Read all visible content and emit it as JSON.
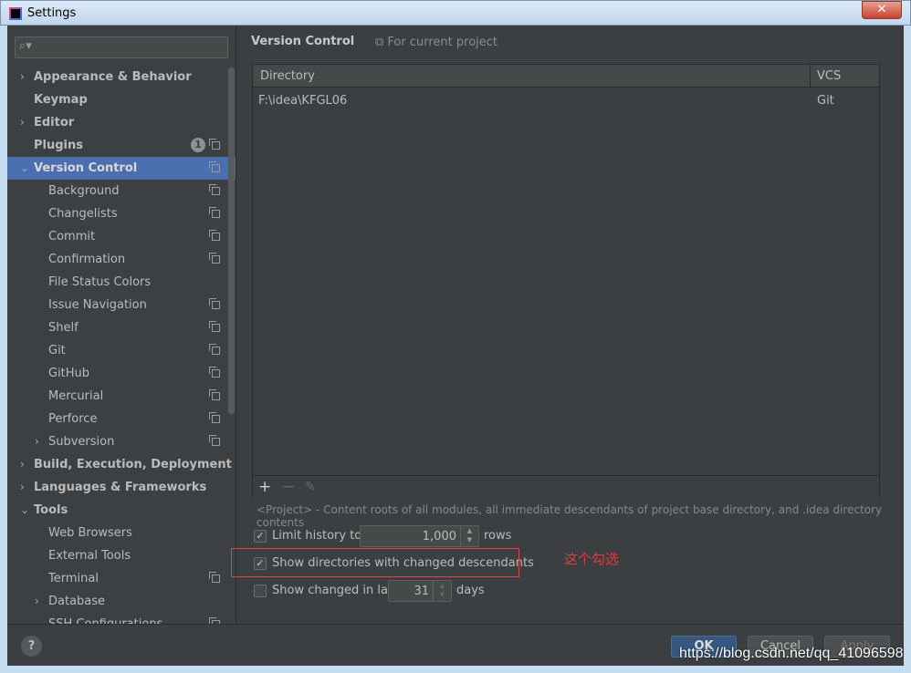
{
  "window": {
    "title": "Settings",
    "close": "✕"
  },
  "sidebar": {
    "search_placeholder": "",
    "items": [
      {
        "label": "Appearance & Behavior",
        "level": 1,
        "arrow": "›",
        "bold": true
      },
      {
        "label": "Keymap",
        "level": 1,
        "bold": true
      },
      {
        "label": "Editor",
        "level": 1,
        "arrow": "›",
        "bold": true
      },
      {
        "label": "Plugins",
        "level": 1,
        "bold": true,
        "badge": "1",
        "copy": true
      },
      {
        "label": "Version Control",
        "level": 1,
        "arrow": "⌄",
        "bold": true,
        "copy": true,
        "selected": true
      },
      {
        "label": "Background",
        "level": 2,
        "copy": true
      },
      {
        "label": "Changelists",
        "level": 2,
        "copy": true
      },
      {
        "label": "Commit",
        "level": 2,
        "copy": true
      },
      {
        "label": "Confirmation",
        "level": 2,
        "copy": true
      },
      {
        "label": "File Status Colors",
        "level": 2
      },
      {
        "label": "Issue Navigation",
        "level": 2,
        "copy": true
      },
      {
        "label": "Shelf",
        "level": 2,
        "copy": true
      },
      {
        "label": "Git",
        "level": 2,
        "copy": true
      },
      {
        "label": "GitHub",
        "level": 2,
        "copy": true
      },
      {
        "label": "Mercurial",
        "level": 2,
        "copy": true
      },
      {
        "label": "Perforce",
        "level": 2,
        "copy": true
      },
      {
        "label": "Subversion",
        "level": 2,
        "arrow": "›",
        "copy": true
      },
      {
        "label": "Build, Execution, Deployment",
        "level": 1,
        "arrow": "›",
        "bold": true
      },
      {
        "label": "Languages & Frameworks",
        "level": 1,
        "arrow": "›",
        "bold": true
      },
      {
        "label": "Tools",
        "level": 1,
        "arrow": "⌄",
        "bold": true
      },
      {
        "label": "Web Browsers",
        "level": 2
      },
      {
        "label": "External Tools",
        "level": 2
      },
      {
        "label": "Terminal",
        "level": 2,
        "copy": true
      },
      {
        "label": "Database",
        "level": 2,
        "arrow": "›"
      },
      {
        "label": "SSH Configurations",
        "level": 2,
        "copy": true
      }
    ]
  },
  "main": {
    "title": "Version Control",
    "scope": "For current project",
    "table": {
      "headers": [
        "Directory",
        "VCS"
      ],
      "rows": [
        [
          "F:\\idea\\KFGL06",
          "Git"
        ]
      ]
    },
    "toolbar": {
      "add": "+",
      "remove": "−",
      "edit": "✎"
    },
    "hint": "<Project> - Content roots of all modules, all immediate descendants of project base directory, and .idea directory contents",
    "limit_history": {
      "checked": true,
      "label": "Limit history to:",
      "value": "1,000",
      "unit": "rows"
    },
    "show_dirs": {
      "checked": true,
      "label": "Show directories with changed descendants"
    },
    "show_changed": {
      "checked": false,
      "label": "Show changed in last",
      "value": "31",
      "unit": "days"
    },
    "annotation": "这个勾选",
    "annotation_color": "#e03a3a"
  },
  "footer": {
    "help": "?",
    "ok": "OK",
    "cancel": "Cancel",
    "apply": "Apply"
  },
  "watermark": "https://blog.csdn.net/qq_41096598"
}
